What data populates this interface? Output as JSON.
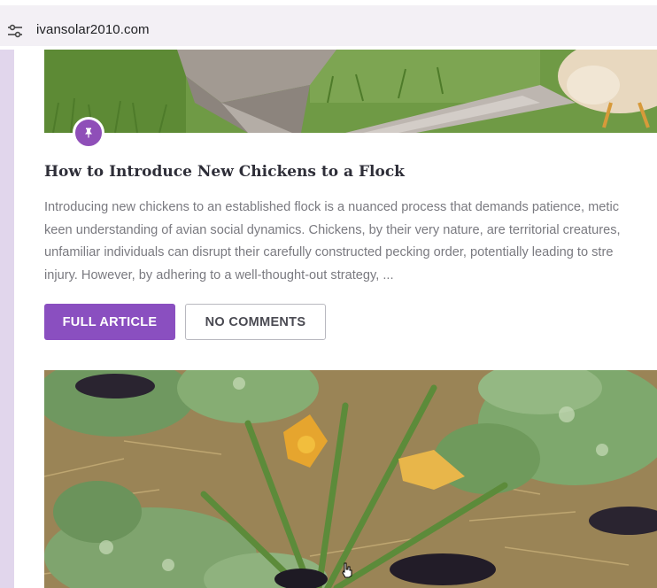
{
  "browser": {
    "url": "ivansolar2010.com",
    "site_info_icon": "tune-icon"
  },
  "post": {
    "title": "How to Introduce New Chickens to a Flock",
    "badge_icon": "pin-icon",
    "excerpt_lines": [
      "Introducing new chickens to an established flock is a nuanced process that demands patience, metic",
      "keen understanding of avian social dynamics. Chickens, by their very nature, are territorial creatures,",
      "unfamiliar individuals can disrupt their carefully constructed pecking order, potentially leading to stre",
      "injury. However, by adhering to a well-thought-out strategy, ..."
    ],
    "primary_button": "FULL ARTICLE",
    "secondary_button": "NO COMMENTS"
  },
  "colors": {
    "accent": "#8a4fc0",
    "badge": "#8f4fb8",
    "title": "#2e2e38",
    "excerpt": "#7a7a80"
  }
}
